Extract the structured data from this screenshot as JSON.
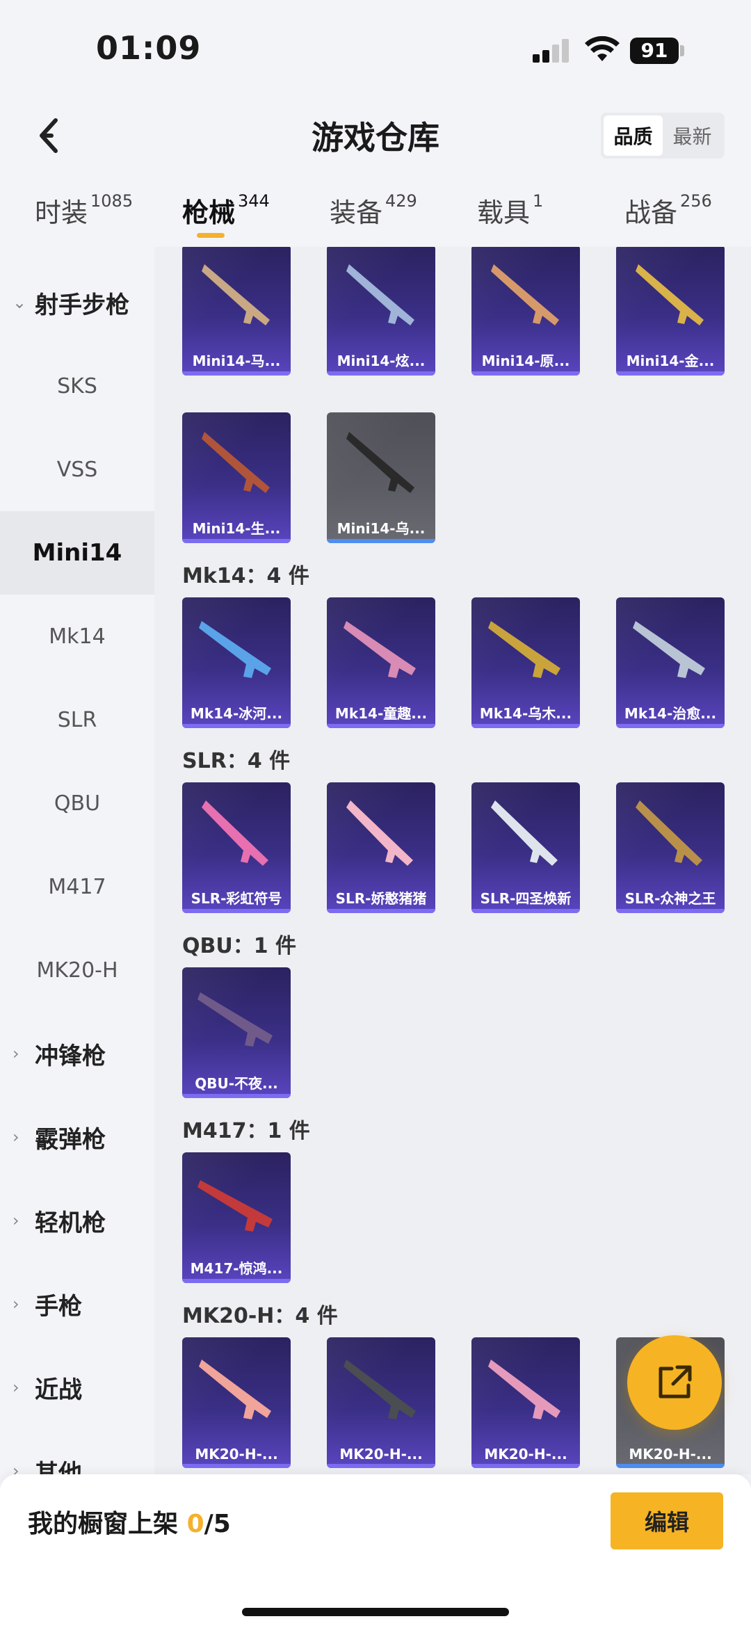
{
  "status_bar": {
    "time": "01:09",
    "battery": "91"
  },
  "header": {
    "title": "游戏仓库",
    "sort_options": [
      "品质",
      "最新"
    ],
    "active_sort": "品质"
  },
  "tabs": [
    {
      "label": "时装",
      "count": "1085"
    },
    {
      "label": "枪械",
      "count": "344"
    },
    {
      "label": "装备",
      "count": "429"
    },
    {
      "label": "载具",
      "count": "1"
    },
    {
      "label": "战备",
      "count": "256"
    }
  ],
  "sidebar": {
    "group_open": "射手步枪",
    "sub_items": [
      "SKS",
      "VSS",
      "Mini14",
      "Mk14",
      "SLR",
      "QBU",
      "M417",
      "MK20-H"
    ],
    "active_item": "Mini14",
    "groups_closed": [
      "冲锋枪",
      "霰弹枪",
      "轻机枪",
      "手枪",
      "近战",
      "其他"
    ]
  },
  "content": {
    "mini14_row1": [
      "Mini14-马...",
      "Mini14-炫...",
      "Mini14-原...",
      "Mini14-金..."
    ],
    "mini14_row2": [
      "Mini14-生...",
      "Mini14-乌..."
    ],
    "sections": [
      {
        "title": "Mk14：4 件",
        "items": [
          "Mk14-冰河...",
          "Mk14-童趣...",
          "Mk14-乌木...",
          "Mk14-治愈..."
        ]
      },
      {
        "title": "SLR：4 件",
        "items": [
          "SLR-彩虹符号",
          "SLR-娇憨猪猪",
          "SLR-四圣焕新",
          "SLR-众神之王"
        ]
      },
      {
        "title": "QBU：1 件",
        "items": [
          "QBU-不夜..."
        ]
      },
      {
        "title": "M417：1 件",
        "items": [
          "M417-惊鸿..."
        ]
      },
      {
        "title": "MK20-H：4 件",
        "items": [
          "MK20-H-...",
          "MK20-H-...",
          "MK20-H-...",
          "MK20-H-..."
        ]
      }
    ]
  },
  "bottom_bar": {
    "shelf_label": "我的橱窗上架",
    "shelf_current": "0",
    "shelf_total": "/5",
    "edit_label": "编辑"
  },
  "colors": {
    "accent": "#f6b324",
    "card_purple": "#3a2f86"
  }
}
